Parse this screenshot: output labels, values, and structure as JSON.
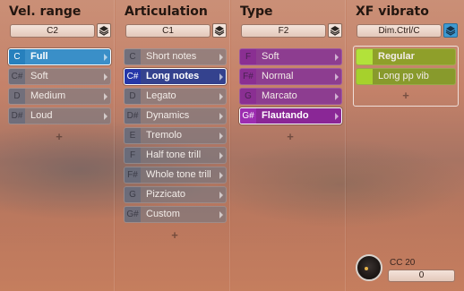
{
  "columns": [
    {
      "title": "Vel. range",
      "key": "C2",
      "layers_active": false,
      "items": [
        {
          "note": "C",
          "label": "Full",
          "style": "blue",
          "selected": true
        },
        {
          "note": "C#",
          "label": "Soft",
          "style": "grey",
          "selected": false
        },
        {
          "note": "D",
          "label": "Medium",
          "style": "grey",
          "selected": false
        },
        {
          "note": "D#",
          "label": "Loud",
          "style": "grey",
          "selected": false
        }
      ],
      "add": "+"
    },
    {
      "title": "Articulation",
      "key": "C1",
      "layers_active": false,
      "items": [
        {
          "note": "C",
          "label": "Short notes",
          "style": "grey",
          "selected": false
        },
        {
          "note": "C#",
          "label": "Long notes",
          "style": "navy",
          "selected": true
        },
        {
          "note": "D",
          "label": "Legato",
          "style": "grey",
          "selected": false
        },
        {
          "note": "D#",
          "label": "Dynamics",
          "style": "grey",
          "selected": false
        },
        {
          "note": "E",
          "label": "Tremolo",
          "style": "grey",
          "selected": false
        },
        {
          "note": "F",
          "label": "Half tone trill",
          "style": "grey",
          "selected": false
        },
        {
          "note": "F#",
          "label": "Whole tone trill",
          "style": "grey",
          "selected": false
        },
        {
          "note": "G",
          "label": "Pizzicato",
          "style": "grey",
          "selected": false
        },
        {
          "note": "G#",
          "label": "Custom",
          "style": "grey",
          "selected": false
        }
      ],
      "add": "+"
    },
    {
      "title": "Type",
      "key": "F2",
      "layers_active": false,
      "items": [
        {
          "note": "F",
          "label": "Soft",
          "style": "purple",
          "selected": false
        },
        {
          "note": "F#",
          "label": "Normal",
          "style": "purple",
          "selected": false
        },
        {
          "note": "G",
          "label": "Marcato",
          "style": "purple",
          "selected": false
        },
        {
          "note": "G#",
          "label": "Flautando",
          "style": "magenta",
          "selected": true
        }
      ],
      "add": "+"
    },
    {
      "title": "XF vibrato",
      "key": "Dim.Ctrl/C",
      "layers_active": true,
      "items": [
        {
          "note": "",
          "label": "Regular",
          "style": "olive-sel",
          "selected": true
        },
        {
          "note": "",
          "label": "Long pp vib",
          "style": "olive",
          "selected": false
        }
      ],
      "add": "+"
    }
  ],
  "cc": {
    "label": "CC 20",
    "value": "0"
  }
}
